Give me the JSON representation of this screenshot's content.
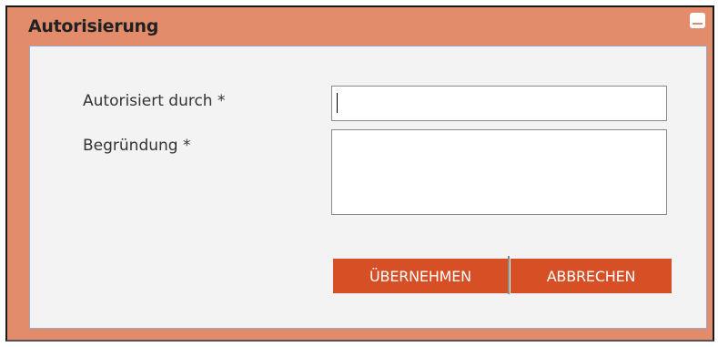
{
  "dialog": {
    "title": "Autorisierung",
    "minimize_icon": "minimize-icon",
    "accent_color": "#e38c6c"
  },
  "form": {
    "authorized_by_label": "Autorisiert durch *",
    "authorized_by_value": "",
    "reason_label": "Begründung *",
    "reason_value": ""
  },
  "buttons": {
    "apply_label": "ÜBERNEHMEN",
    "cancel_label": "ABBRECHEN",
    "button_color": "#d64f25"
  }
}
